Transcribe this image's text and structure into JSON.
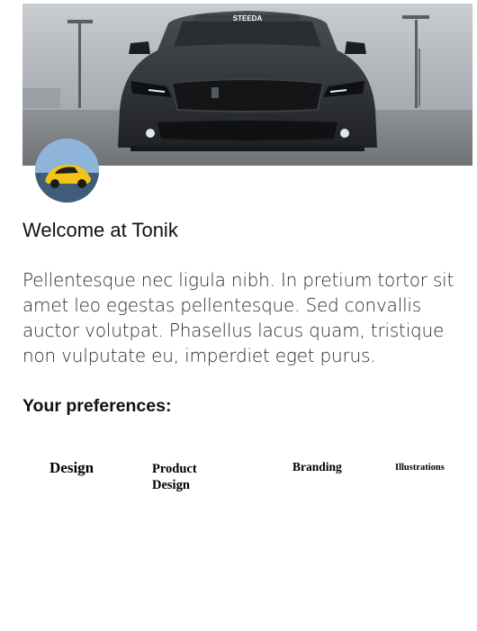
{
  "hero": {
    "plate_text": "STEEDA",
    "icon": "car-hero-image"
  },
  "avatar": {
    "icon": "yellow-car-avatar"
  },
  "welcome": {
    "title": "Welcome at Tonik"
  },
  "intro": {
    "text": "Pellentesque nec ligula nibh. In pretium tortor sit amet leo egestas pellentesque. Sed convallis auctor volutpat. Phasellus lacus quam, tristique non vulputate eu, imperdiet eget purus."
  },
  "preferences": {
    "title": "Your preferences:",
    "items": [
      {
        "label": "Design"
      },
      {
        "label": "Product Design"
      },
      {
        "label": "Branding"
      },
      {
        "label": "Illustrations"
      }
    ]
  },
  "colors": {
    "background": "#ffffff",
    "text": "#111111",
    "car": "#2b2e31"
  }
}
